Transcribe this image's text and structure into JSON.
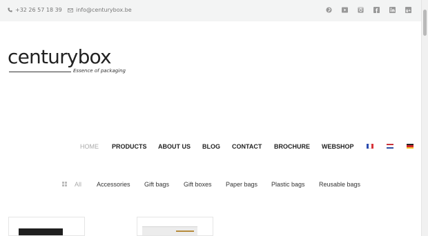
{
  "topbar": {
    "phone": "+32 26 57 18 39",
    "email": "info@centurybox.be",
    "socials": [
      "pinterest-icon",
      "youtube-icon",
      "instagram-icon",
      "facebook-icon",
      "linkedin-icon",
      "google-plus-icon"
    ]
  },
  "logo": {
    "word": "centurybox",
    "tagline": "Essence of packaging"
  },
  "nav": {
    "items": [
      "HOME",
      "PRODUCTS",
      "ABOUT US",
      "BLOG",
      "CONTACT",
      "BROCHURE",
      "WEBSHOP"
    ],
    "active": "HOME",
    "languages": [
      "french-flag-icon",
      "dutch-flag-icon",
      "german-flag-icon"
    ]
  },
  "filter": {
    "items": [
      "All",
      "Accessories",
      "Gift bags",
      "Gift boxes",
      "Paper bags",
      "Plastic bags",
      "Reusable bags"
    ],
    "active": "All"
  },
  "colors": {
    "topbar_bg": "#f3f4f4",
    "active_nav": "#aaaaaa",
    "text": "#222222"
  }
}
